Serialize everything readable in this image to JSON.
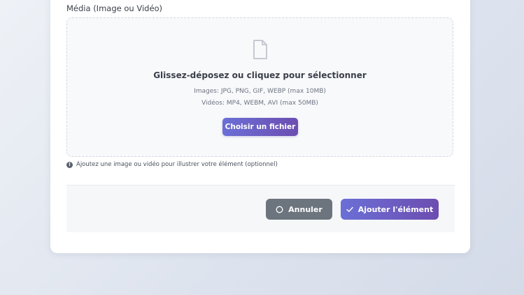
{
  "form": {
    "media_label": "Média (Image ou Vidéo)"
  },
  "dropzone": {
    "icon": "file-icon",
    "title": "Glissez-déposez ou cliquez pour sélectionner",
    "images_line": "Images: JPG, PNG, GIF, WEBP (max 10MB)",
    "videos_line": "Vidéos: MP4, WEBM, AVI (max 50MB)",
    "choose_button": "Choisir un fichier"
  },
  "help": {
    "icon": "info-icon",
    "text": "Ajoutez une image ou vidéo pour illustrer votre élément (optionnel)"
  },
  "actions": {
    "cancel_label": "Annuler",
    "cancel_icon": "circle-icon",
    "add_label": "Ajouter l'élément",
    "add_icon": "check-icon"
  },
  "colors": {
    "primary_gradient_start": "#6b6fd6",
    "primary_gradient_end": "#6c4db0",
    "cancel_gray": "#6c747d"
  }
}
